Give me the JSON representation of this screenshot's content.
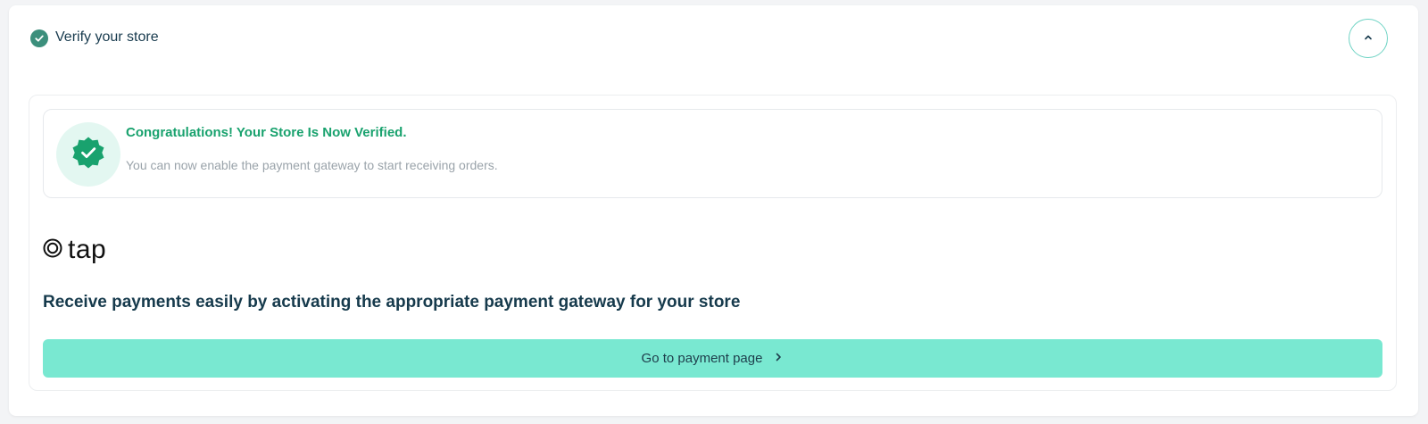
{
  "header": {
    "title": "Verify your store",
    "status_icon": "check-circle-icon",
    "collapse_icon": "chevron-up-icon"
  },
  "notice": {
    "icon": "verified-badge-icon",
    "title": "Congratulations! Your Store Is Now Verified.",
    "text": "You can now enable the payment gateway to start receiving orders."
  },
  "gateway": {
    "logo_text": "tap",
    "headline": "Receive payments easily by activating the appropriate payment gateway for your store",
    "button_label": "Go to payment page",
    "button_icon": "chevron-right-icon"
  },
  "colors": {
    "accent": "#79e8d1",
    "success": "#19a26e",
    "heading": "#163a4c"
  }
}
